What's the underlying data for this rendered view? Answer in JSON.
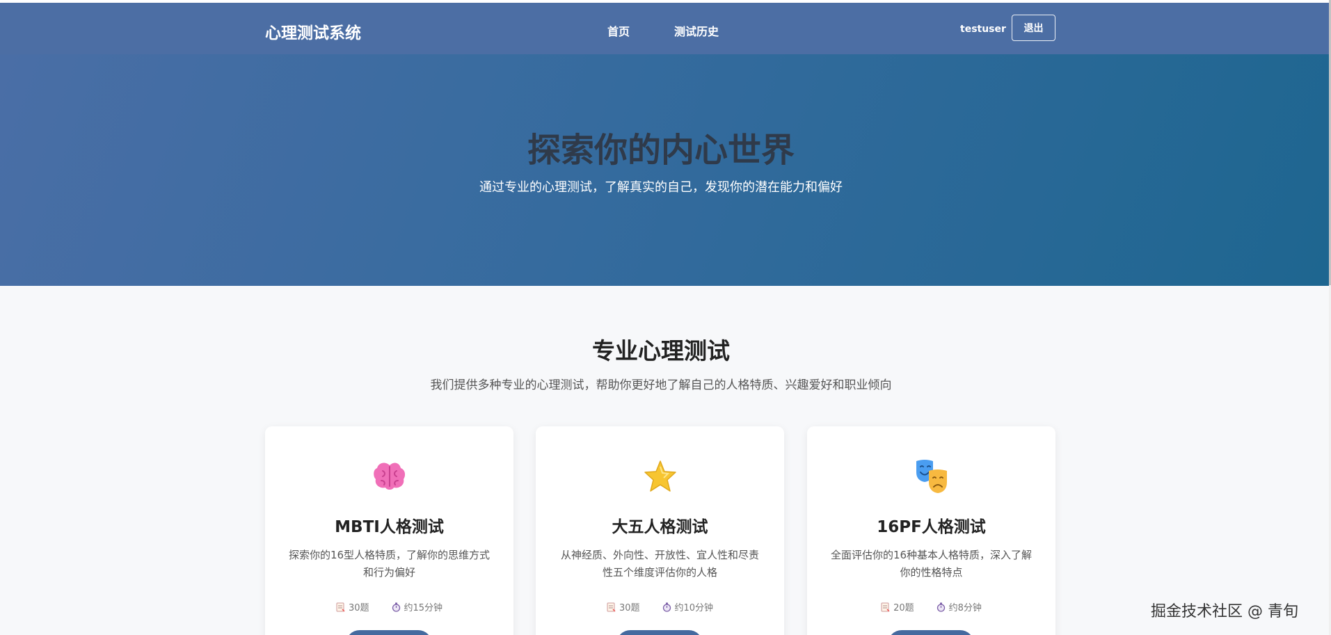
{
  "navbar": {
    "brand": "心理测试系统",
    "links": [
      {
        "label": "首页"
      },
      {
        "label": "测试历史"
      }
    ],
    "username": "testuser",
    "logout_label": "退出",
    "background_color": "#4c6ea4"
  },
  "hero": {
    "title": "探索你的内心世界",
    "subtitle": "通过专业的心理测试，了解真实的自己，发现你的潜在能力和偏好"
  },
  "section": {
    "title": "专业心理测试",
    "subtitle": "我们提供多种专业的心理测试，帮助你更好地了解自己的人格特质、兴趣爱好和职业倾向"
  },
  "cards": [
    {
      "icon": "brain-icon",
      "title": "MBTI人格测试",
      "description": "探索你的16型人格特质，了解你的思维方式和行为偏好",
      "questions": "30题",
      "duration": "约15分钟"
    },
    {
      "icon": "star-icon",
      "title": "大五人格测试",
      "description": "从神经质、外向性、开放性、宜人性和尽责性五个维度评估你的人格",
      "questions": "30题",
      "duration": "约10分钟"
    },
    {
      "icon": "theater-masks-icon",
      "title": "16PF人格测试",
      "description": "全面评估你的16种基本人格特质，深入了解你的性格特点",
      "questions": "20题",
      "duration": "约8分钟"
    }
  ],
  "watermark": "掘金技术社区 @ 青旬",
  "colors": {
    "accent": "#456a9f",
    "hero_start": "#4a6ea6",
    "hero_end": "#1e6690"
  }
}
